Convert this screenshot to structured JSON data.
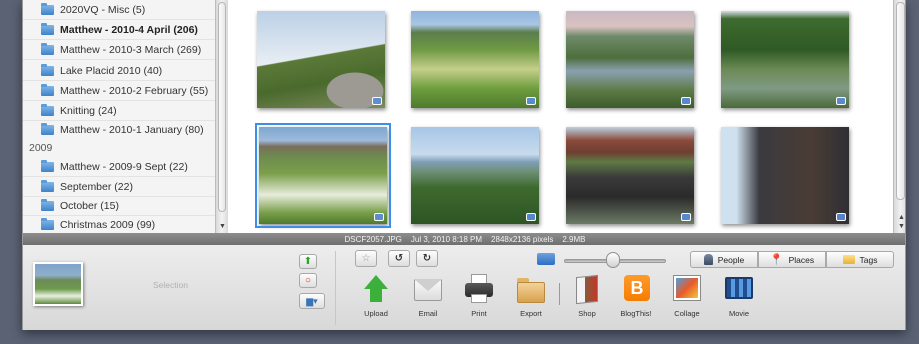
{
  "sidebar": {
    "folders_2010": [
      {
        "label": "2020VQ - Misc (5)",
        "bold": false
      },
      {
        "label": "Matthew - 2010-4 April (206)",
        "bold": true
      },
      {
        "label": "Matthew - 2010-3 March (269)",
        "bold": false
      },
      {
        "label": "Lake Placid 2010 (40)",
        "bold": false
      },
      {
        "label": "Matthew - 2010-2 February (55)",
        "bold": false
      },
      {
        "label": "Knitting (24)",
        "bold": false
      },
      {
        "label": "Matthew - 2010-1 January (80)",
        "bold": false
      }
    ],
    "year": "2009",
    "folders_2009": [
      {
        "label": "Matthew - 2009-9 Sept (22)"
      },
      {
        "label": "September (22)"
      },
      {
        "label": "October (15)"
      },
      {
        "label": "Christmas 2009 (99)"
      }
    ]
  },
  "status": {
    "filename": "DSCF2057.JPG",
    "date": "Jul 3, 2010 8:18 PM",
    "dimensions": "2848x2136 pixels",
    "size": "2.9MB"
  },
  "selection": {
    "label": "Selection"
  },
  "tools": [
    {
      "label": "Upload",
      "icon": "upload-icon"
    },
    {
      "label": "Email",
      "icon": "email-icon"
    },
    {
      "label": "Print",
      "icon": "print-icon"
    },
    {
      "label": "Export",
      "icon": "export-folder-icon"
    },
    {
      "label": "Shop",
      "icon": "shop-icon"
    },
    {
      "label": "BlogThis!",
      "icon": "blogger-icon"
    },
    {
      "label": "Collage",
      "icon": "collage-icon"
    },
    {
      "label": "Movie",
      "icon": "movie-icon"
    }
  ],
  "tags": {
    "people": "People",
    "places": "Places",
    "tags": "Tags"
  },
  "colors": {
    "selection_outline": "#3a8fe8",
    "folder": "#4a8fd4",
    "blogger": "#f57d00"
  }
}
